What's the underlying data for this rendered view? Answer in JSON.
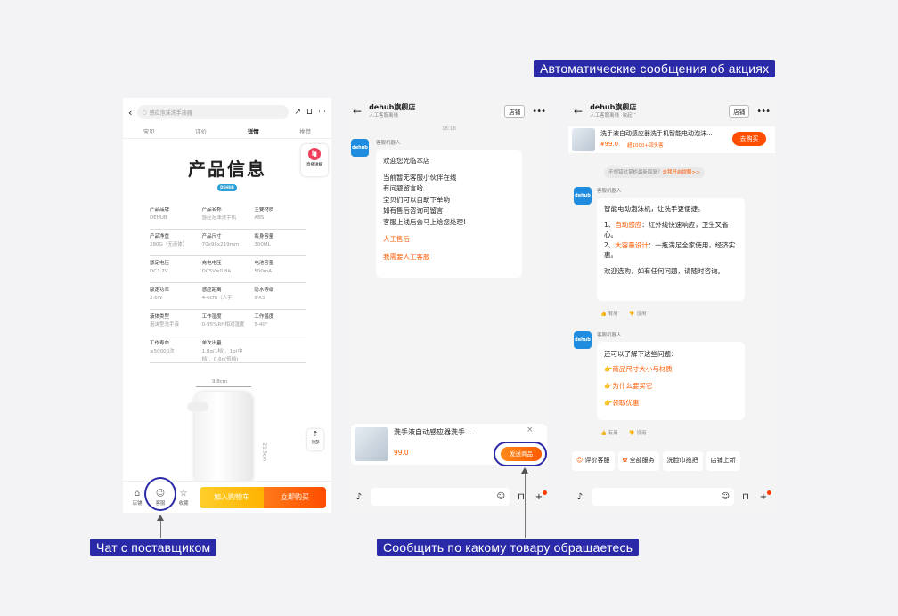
{
  "labels": {
    "promo": "Автоматические сообщения об акциях",
    "supplier_chat": "Чат с поставщиком",
    "product_ref": "Сообщить по какому товару обращаетесь"
  },
  "product_page": {
    "search_placeholder": "感应泡沫洗手液器",
    "tabs": [
      "宝贝",
      "评价",
      "详情",
      "推荐"
    ],
    "heading": "产品信息",
    "brand_badge": "DEHUB",
    "live_label": "直播讲解",
    "specs": [
      [
        {
          "k": "产品品牌",
          "v": "DEHUB"
        },
        {
          "k": "产品名称",
          "v": "感应泡沫洗手机"
        },
        {
          "k": "主要材质",
          "v": "ABS"
        }
      ],
      [
        {
          "k": "产品净重",
          "v": "280G（无液体）"
        },
        {
          "k": "产品尺寸",
          "v": "70x98x219mm"
        },
        {
          "k": "瓶身容量",
          "v": "300ML"
        }
      ],
      [
        {
          "k": "额定电压",
          "v": "DC3.7V"
        },
        {
          "k": "充电电压",
          "v": "DC5V=0.8A"
        },
        {
          "k": "电池容量",
          "v": "500mA"
        }
      ],
      [
        {
          "k": "额定功率",
          "v": "2.6W"
        },
        {
          "k": "感应距离",
          "v": "4-6cm（人手）"
        },
        {
          "k": "防水等级",
          "v": "IPX5"
        }
      ],
      [
        {
          "k": "液体类型",
          "v": "泡沫型洗手液"
        },
        {
          "k": "工作湿度",
          "v": "0-95%RH相对湿度"
        },
        {
          "k": "工作温度",
          "v": "5-40°"
        }
      ],
      [
        {
          "k": "工作寿命",
          "v": "≥50000次"
        },
        {
          "k": "单次出量",
          "v": "1.8g(1档)、1g(中档)、0.6g(低档)"
        },
        {
          "k": "",
          "v": ""
        }
      ]
    ],
    "dim_width": "9.8cm",
    "dim_height": "21.9cm",
    "back_top": "顶部",
    "bottom_icons": [
      "店铺",
      "客服",
      "收藏"
    ],
    "add_cart": "加入购物车",
    "buy_now": "立即购买"
  },
  "chat1": {
    "shop_name": "dehub旗舰店",
    "status": "人工客服离线",
    "shop_btn": "店铺",
    "time": "18:18",
    "bot_name": "客服机器人",
    "avatar_text": "dehub",
    "msg_lines": [
      "欢迎您光临本店",
      "当前暂无客服小伙伴在线",
      "有问题留言哈",
      "宝贝们可以自助下单哟",
      "如有售后咨询可留言",
      "客服上线后会马上给您处理!"
    ],
    "link1": "人工售后",
    "link2": "我需要人工客服",
    "product_title": "洗手液自动感应器洗手...",
    "price": "99.0",
    "send_btn": "发送商品"
  },
  "chat2": {
    "shop_name": "dehub旗舰店",
    "status": "人工客服离线",
    "collapse": "收起",
    "shop_btn": "店铺",
    "promo_title": "洗手液自动感应器洗手机智能电动泡沫...",
    "promo_price": "¥99.0",
    "promo_sold": "超1000+回头客",
    "promo_btn": "去购买",
    "notice": "不想错过掌柜最新回复？",
    "notice_link": "去我开启提醒>>",
    "bot_name": "客服机器人",
    "avatar_text": "dehub",
    "msg1_title": "智能电动泡沫机，让洗手更便捷。",
    "msg1_l1_a": "1、",
    "msg1_l1_b": "自动感应",
    "msg1_l1_c": "：红外线快速响应，卫生又省心。",
    "msg1_l2_a": "2、",
    "msg1_l2_b": "大容量设计",
    "msg1_l2_c": "：一瓶满足全家使用，经济实惠。",
    "msg1_end": "欢迎选购，如有任何问题，请随时咨询。",
    "useful": "有用",
    "useless": "没用",
    "msg2_title": "还可以了解下这些问题：",
    "faq": [
      "商品尺寸大小与材质",
      "为什么要买它",
      "领取优惠"
    ],
    "quick": [
      "评价客服",
      "全部服务",
      "洗脸巾拖把",
      "店铺上新"
    ]
  }
}
